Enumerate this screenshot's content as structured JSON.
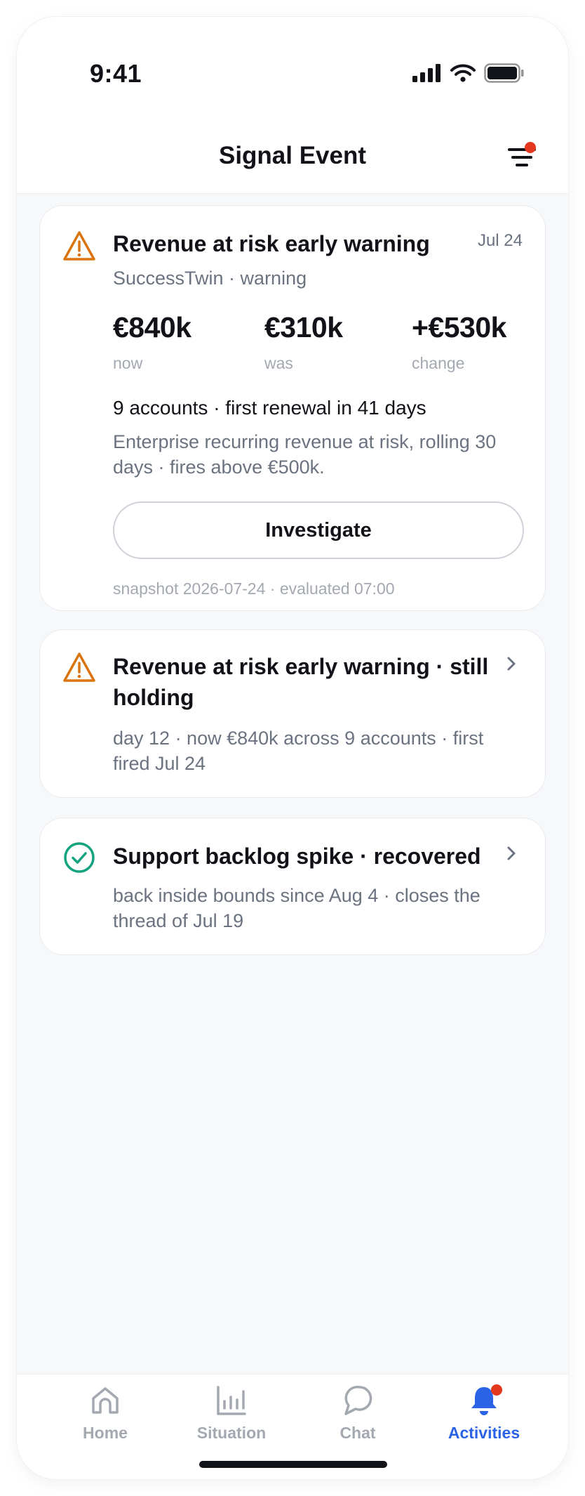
{
  "status_bar": {
    "time": "9:41"
  },
  "header": {
    "title": "Signal Event"
  },
  "primary_event": {
    "title": "Revenue at risk early warning",
    "date": "Jul 24",
    "source": "SuccessTwin · warning",
    "metrics": [
      {
        "value": "€840k",
        "label": "now"
      },
      {
        "value": "€310k",
        "label": "was"
      },
      {
        "value": "+€530k",
        "label": "change"
      }
    ],
    "accounts_line": "9 accounts · first renewal in 41 days",
    "description": "Enterprise recurring revenue at risk, rolling 30 days · fires above €500k.",
    "action_label": "Investigate",
    "snapshot": "snapshot 2026-07-24 · evaluated 07:00",
    "status_color": "#d9740f"
  },
  "followups": [
    {
      "title": "Revenue at risk early warning · still holding",
      "detail": "day 12 · now €840k across 9 accounts · first fired Jul 24",
      "icon": "warning-icon",
      "color": "#d9740f"
    },
    {
      "title": "Support backlog spike · recovered",
      "detail": "back inside bounds since Aug 4 · closes the thread of Jul 19",
      "icon": "check-circle-icon",
      "color": "#14a37f"
    }
  ],
  "tab_bar": {
    "tabs": [
      {
        "label": "Home",
        "icon": "home-icon"
      },
      {
        "label": "Situation",
        "icon": "bar-chart-icon"
      },
      {
        "label": "Chat",
        "icon": "chat-icon"
      },
      {
        "label": "Activities",
        "icon": "bell-icon",
        "active": true
      }
    ],
    "accent": "#2b63e6"
  }
}
